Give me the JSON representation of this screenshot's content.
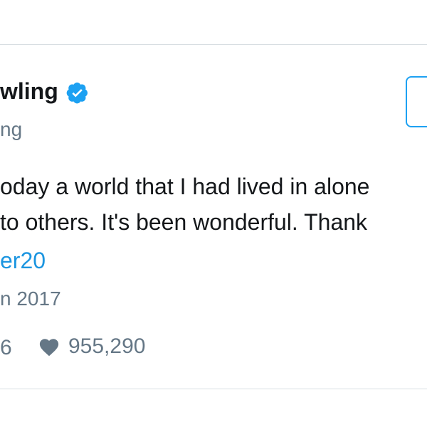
{
  "tweet": {
    "author_name": "wling",
    "author_handle": "ng",
    "text_line_1": "oday a world that I had lived in alone",
    "text_line_2": "to others. It's been wonderful. Thank",
    "hashtag": "er20",
    "date": "n 2017",
    "retweet_count": "6",
    "like_count": "955,290"
  },
  "icons": {
    "verified": "verified-badge-icon",
    "like": "heart-icon"
  },
  "colors": {
    "link": "#1b95e0",
    "verified": "#1da1f2",
    "muted": "#657786",
    "text": "#14171a",
    "border": "#d8dee2"
  }
}
